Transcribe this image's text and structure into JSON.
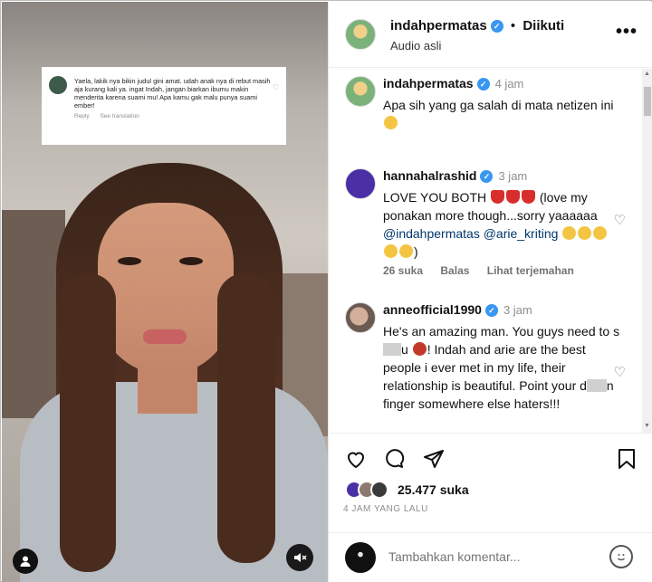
{
  "video": {
    "overlay_comment": {
      "text": "Yaela, lakik nya bikin judul gini amat. udah anak nya di rebut masih aja kurang kali ya. ingat Indah, jangan biarkan ibumu makin menderita karena suami mu! Apa kamu gak malu punya suami ember!",
      "reply": "Reply",
      "see_translation": "See translation"
    }
  },
  "header": {
    "username": "indahpermatas",
    "separator": "•",
    "follow_status": "Diikuti",
    "subtitle": "Audio asli",
    "more": "•••"
  },
  "comments": [
    {
      "username": "indahpermatas",
      "time": "4 jam",
      "text": "Apa sih yang ga salah di mata netizen ini"
    },
    {
      "username": "hannahalrashid",
      "time": "3 jam",
      "text_a": "LOVE YOU BOTH",
      "text_b": "(love my ponakan more though...sorry yaaaaaa",
      "mention1": "@indahpermatas",
      "mention2": "@arie_kriting",
      "text_c": ")",
      "likes": "26 suka",
      "reply": "Balas",
      "translate": "Lihat terjemahan"
    },
    {
      "username": "anneofficial1990",
      "time": "3 jam",
      "text_a": "He's an amazing man. You guys need to s",
      "text_a2": "u",
      "text_b": "! Indah and arie are the best people i ever met in my life, their relationship is beautiful. Point your d",
      "text_c": "n finger somewhere else haters!!!"
    }
  ],
  "actions": {
    "likes": "25.477 suka",
    "time_ago": "4 JAM YANG LALU"
  },
  "add_comment": {
    "placeholder": "Tambahkan komentar..."
  },
  "colors": {
    "verified": "#3897f0",
    "mention": "#00376b",
    "muted": "#8e8e8e"
  }
}
